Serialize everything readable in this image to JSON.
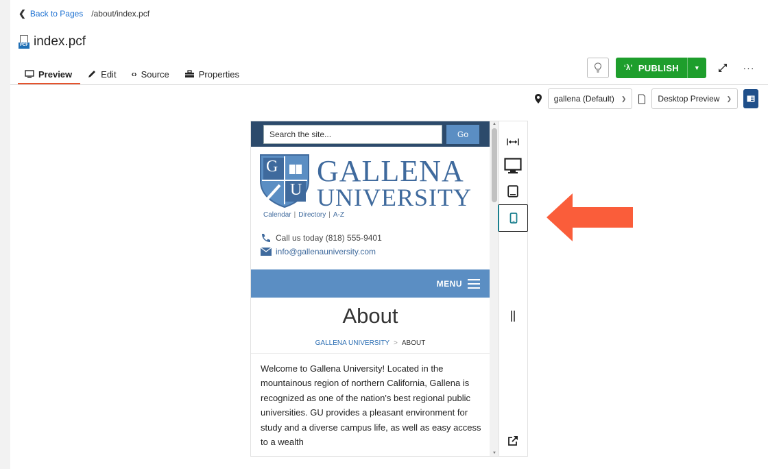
{
  "nav": {
    "back_label": "Back to Pages",
    "path": "/about/index.pcf"
  },
  "file": {
    "name": "index.pcf",
    "icon_tag": "PCF"
  },
  "tabs": [
    {
      "label": "Preview",
      "icon": "monitor-icon",
      "active": true
    },
    {
      "label": "Edit",
      "icon": "pencil-icon"
    },
    {
      "label": "Source",
      "icon": "code-icon"
    },
    {
      "label": "Properties",
      "icon": "toolbox-icon"
    }
  ],
  "toolbar": {
    "publish_label": "PUBLISH"
  },
  "preview": {
    "server_label": "gallena (Default)",
    "mode_label": "Desktop Preview"
  },
  "site": {
    "search_placeholder": "Search the site...",
    "go_label": "Go",
    "logo_line1": "GALLENA",
    "logo_line2": "UNIVERSITY",
    "shield_letters": [
      "G",
      "U"
    ],
    "quicklinks": [
      "Calendar",
      "Directory",
      "A-Z"
    ],
    "quicklink_sep": "|",
    "phone": "Call us today (818) 555-9401",
    "email": "info@gallenauniversity.com",
    "menu_label": "MENU",
    "page_title": "About",
    "breadcrumb": [
      "GALLENA UNIVERSITY",
      "ABOUT"
    ],
    "breadcrumb_sep": ">",
    "body": "Welcome to Gallena University! Located in the mountainous region of northern California, Gallena is recognized as one of the nation's best regional public universities. GU provides a pleasant environment for study and a diverse campus life, as well as easy access to a wealth"
  },
  "colors": {
    "publish_green": "#1e9e2c",
    "tab_accent": "#e5532d",
    "brand_blue": "#3f6a9d",
    "annotation_arrow": "#fa5d3a"
  }
}
